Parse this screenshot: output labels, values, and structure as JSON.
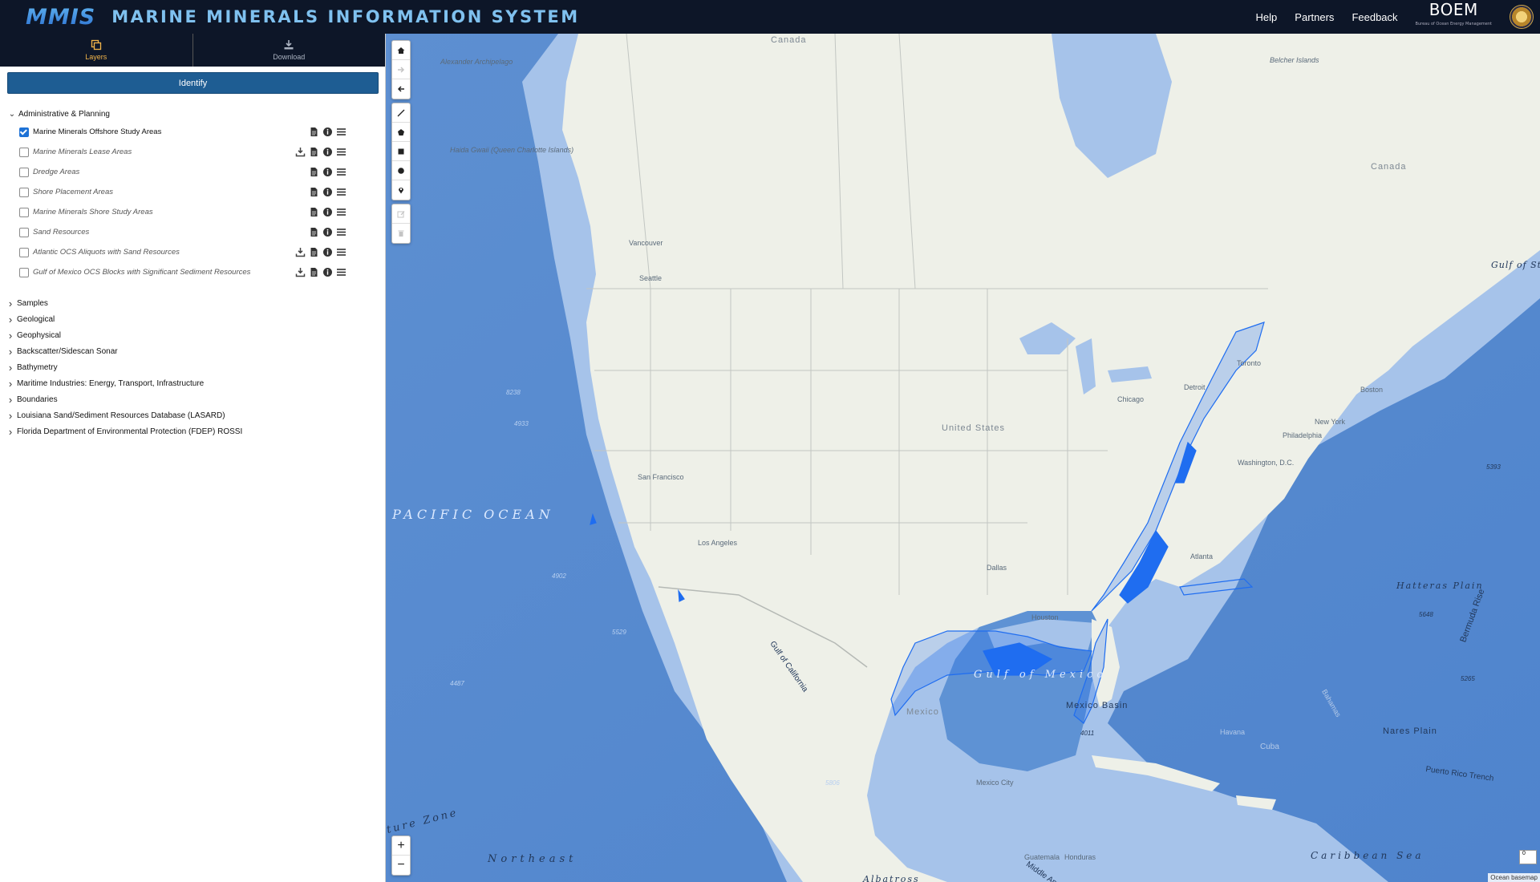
{
  "header": {
    "logo": "MMIS",
    "title": "MARINE MINERALS INFORMATION SYSTEM",
    "links": [
      "Help",
      "Partners",
      "Feedback"
    ],
    "agency_logo": "BOEM",
    "agency_subtitle": "Bureau of Ocean Energy Management"
  },
  "sidebar": {
    "tabs": [
      {
        "label": "Layers",
        "icon": "layers-icon",
        "active": true
      },
      {
        "label": "Download",
        "icon": "download-icon",
        "active": false
      }
    ],
    "identify_label": "Identify",
    "expanded_group": {
      "label": "Administrative & Planning",
      "layers": [
        {
          "label": "Marine Minerals Offshore Study Areas",
          "checked": true,
          "actions": [
            "document",
            "info",
            "menu"
          ]
        },
        {
          "label": "Marine Minerals Lease Areas",
          "checked": false,
          "actions": [
            "download",
            "document",
            "info",
            "menu"
          ]
        },
        {
          "label": "Dredge Areas",
          "checked": false,
          "actions": [
            "document",
            "info",
            "menu"
          ]
        },
        {
          "label": "Shore Placement Areas",
          "checked": false,
          "actions": [
            "document",
            "info",
            "menu"
          ]
        },
        {
          "label": "Marine Minerals Shore Study Areas",
          "checked": false,
          "actions": [
            "document",
            "info",
            "menu"
          ]
        },
        {
          "label": "Sand Resources",
          "checked": false,
          "actions": [
            "document",
            "info",
            "menu"
          ]
        },
        {
          "label": "Atlantic OCS Aliquots with Sand Resources",
          "checked": false,
          "actions": [
            "download",
            "document",
            "info",
            "menu"
          ]
        },
        {
          "label": "Gulf of Mexico OCS Blocks with Significant Sediment Resources",
          "checked": false,
          "actions": [
            "download",
            "document",
            "info",
            "menu"
          ]
        }
      ]
    },
    "collapsed_groups": [
      "Samples",
      "Geological",
      "Geophysical",
      "Backscatter/Sidescan Sonar",
      "Bathymetry",
      "Maritime Industries: Energy, Transport, Infrastructure",
      "Boundaries",
      "Louisiana Sand/Sediment Resources Database (LASARD)",
      "Florida Department of Environmental Protection (FDEP) ROSSI"
    ]
  },
  "map": {
    "toolbar_top": [
      "home-icon",
      "forward-icon",
      "back-icon"
    ],
    "toolbar_draw": [
      "line-icon",
      "polygon-icon",
      "rectangle-icon",
      "circle-icon",
      "point-icon"
    ],
    "toolbar_edit": [
      "edit-icon",
      "trash-icon"
    ],
    "zoom": [
      "+",
      "−"
    ],
    "labels": {
      "pacific": "PACIFIC OCEAN",
      "canada": "Canada",
      "us": "United States",
      "mexico": "Mexico",
      "gulf": "Gulf of Mexico",
      "mexico_basin": "Mexico Basin",
      "hatteras": "Hatteras Plain",
      "nares": "Nares Plain",
      "bermuda": "Bermuda Rise",
      "cuba": "Cuba",
      "northeast": "Northeast",
      "caribbean": "Caribbean Sea",
      "alexander": "Alexander Archipelago",
      "haida": "Haida Gwaii (Queen Charlotte Islands)",
      "belcher": "Belcher Islands",
      "st_lawrence": "Gulf of St. Lawren",
      "vancouver": "Vancouver",
      "seattle": "Seattle",
      "sanfrancisco": "San Francisco",
      "losangeles": "Los Angeles",
      "dallas": "Dallas",
      "houston": "Houston",
      "atlanta": "Atlanta",
      "chicago": "Chicago",
      "detroit": "Detroit",
      "toronto": "Toronto",
      "boston": "Boston",
      "newyork": "New York",
      "philadelphia": "Philadelphia",
      "washington": "Washington, D.C.",
      "havana": "Havana",
      "mexicocity": "Mexico City",
      "guatemala": "Guatemala",
      "honduras": "Honduras",
      "puerto_rico_trench": "Puerto Rico Trench",
      "bahamas": "Bahamas",
      "fracture_zone": "ture Zone",
      "albatross": "Albatross",
      "gulf_of_california": "Gulf of California",
      "middle_america": "Middle Am",
      "depth_8238": "8238",
      "depth_4933": "4933",
      "depth_4902": "4902",
      "depth_5529": "5529",
      "depth_4487": "4487",
      "depth_5806": "5806",
      "depth_5648": "5648",
      "depth_4011": "4011",
      "depth_5265": "5265",
      "depth_5393": "5393"
    },
    "attribution": "Ocean basemap",
    "scale_label": "0",
    "colors": {
      "ocean": "#6b9bd6",
      "land": "#eef0e8",
      "shelf": "#a9c6ea",
      "feature": "#1f6df0"
    }
  }
}
